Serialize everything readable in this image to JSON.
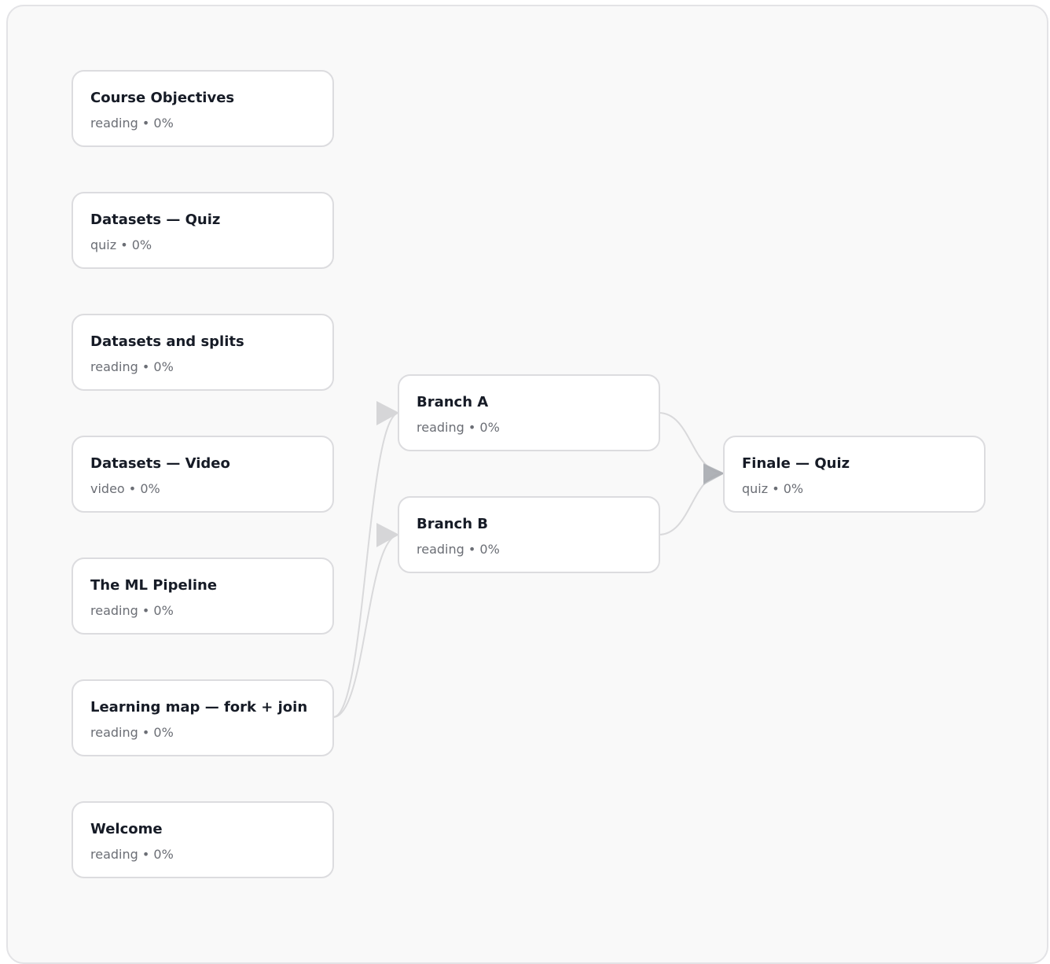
{
  "nodes": [
    {
      "id": "course-objectives",
      "title": "Course Objectives",
      "kind": "reading",
      "progress": "0%",
      "meta": "reading • 0%"
    },
    {
      "id": "datasets-quiz",
      "title": "Datasets — Quiz",
      "kind": "quiz",
      "progress": "0%",
      "meta": "quiz • 0%"
    },
    {
      "id": "datasets-and-splits",
      "title": "Datasets and splits",
      "kind": "reading",
      "progress": "0%",
      "meta": "reading • 0%"
    },
    {
      "id": "datasets-video",
      "title": "Datasets — Video",
      "kind": "video",
      "progress": "0%",
      "meta": "video • 0%"
    },
    {
      "id": "ml-pipeline",
      "title": "The ML Pipeline",
      "kind": "reading",
      "progress": "0%",
      "meta": "reading • 0%"
    },
    {
      "id": "learning-map",
      "title": "Learning map — fork + join",
      "kind": "reading",
      "progress": "0%",
      "meta": "reading • 0%"
    },
    {
      "id": "welcome",
      "title": "Welcome",
      "kind": "reading",
      "progress": "0%",
      "meta": "reading • 0%"
    },
    {
      "id": "branch-a",
      "title": "Branch A",
      "kind": "reading",
      "progress": "0%",
      "meta": "reading • 0%"
    },
    {
      "id": "branch-b",
      "title": "Branch B",
      "kind": "reading",
      "progress": "0%",
      "meta": "reading • 0%"
    },
    {
      "id": "finale-quiz",
      "title": "Finale — Quiz",
      "kind": "quiz",
      "progress": "0%",
      "meta": "quiz • 0%"
    }
  ],
  "edges": [
    {
      "from": "learning-map",
      "to": "branch-a"
    },
    {
      "from": "learning-map",
      "to": "branch-b"
    },
    {
      "from": "branch-a",
      "to": "finale-quiz"
    },
    {
      "from": "branch-b",
      "to": "finale-quiz"
    }
  ],
  "colors": {
    "canvas_bg": "#f9f9f9",
    "node_border": "#dcdcdf",
    "edge": "#d9d9db",
    "arrow_fork": "#d6d6d8",
    "arrow_join": "#a9abb1",
    "title_text": "#161b26",
    "meta_text": "#6b6e75"
  }
}
